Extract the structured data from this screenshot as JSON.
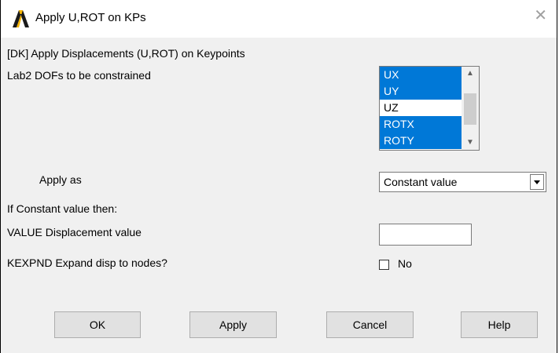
{
  "window": {
    "title": "Apply U,ROT on KPs",
    "close_glyph": "✕",
    "icon": "ansys-logo-icon",
    "accent": "#000000"
  },
  "form": {
    "heading": "[DK]  Apply Displacements (U,ROT) on Keypoints",
    "lab2": {
      "label": "Lab2    DOFs to be constrained"
    },
    "dof_options": [
      {
        "label": "UX",
        "selected": true
      },
      {
        "label": "UY",
        "selected": true
      },
      {
        "label": "UZ",
        "selected": false
      },
      {
        "label": "ROTX",
        "selected": true
      },
      {
        "label": "ROTY",
        "selected": true
      }
    ],
    "apply_as": {
      "label": "Apply as",
      "value": "Constant value"
    },
    "if_constant": "If Constant value then:",
    "value_field": {
      "label": "VALUE   Displacement value",
      "value": ""
    },
    "kexpnd": {
      "label": "KEXPND  Expand disp to nodes?",
      "checkbox_label": "No",
      "checked": false
    }
  },
  "buttons": {
    "ok": "OK",
    "apply": "Apply",
    "cancel": "Cancel",
    "help": "Help"
  },
  "colors": {
    "selection": "#0078d7",
    "dialog_bg": "#f0f0f0",
    "button_bg": "#e1e1e1"
  }
}
